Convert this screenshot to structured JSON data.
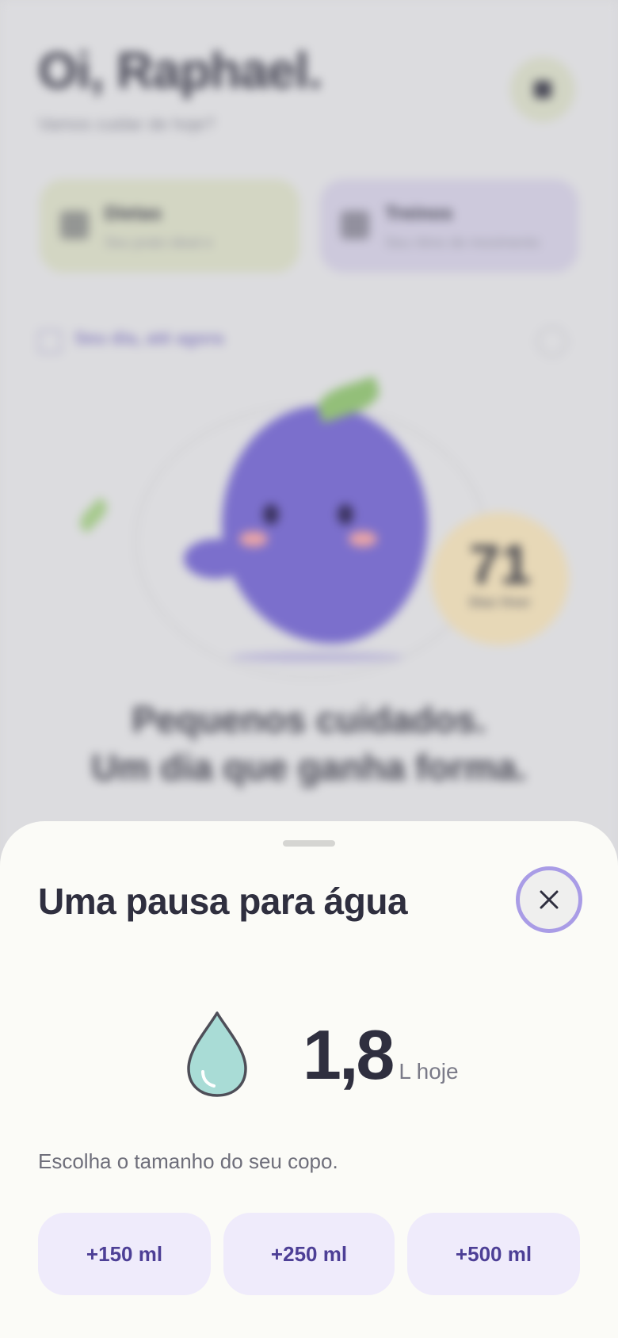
{
  "background": {
    "greeting": "Oi, Raphael.",
    "subgreeting": "Vamos cuidar de hoje?",
    "cards": [
      {
        "title": "Dietas",
        "subtitle": "Seu prato ideal e"
      },
      {
        "title": "Treinos",
        "subtitle": "Seu ritmo de movimento"
      }
    ],
    "day_label": "Seu dia, até agora",
    "score": {
      "value": "71",
      "label": "Dias Viver"
    },
    "tagline_line1": "Pequenos cuidados.",
    "tagline_line2": "Um dia que ganha forma."
  },
  "sheet": {
    "title": "Uma pausa para água",
    "amount_value": "1,8",
    "amount_unit": "L hoje",
    "hint": "Escolha o tamanho do seu copo.",
    "cup_options": [
      "+150 ml",
      "+250 ml",
      "+500 ml"
    ]
  },
  "colors": {
    "accent": "#a99ce6",
    "button_bg": "#efebfb",
    "button_text": "#4d3f96",
    "drop_fill": "#a9dcd6",
    "sheet_bg": "#fbfbf7"
  }
}
